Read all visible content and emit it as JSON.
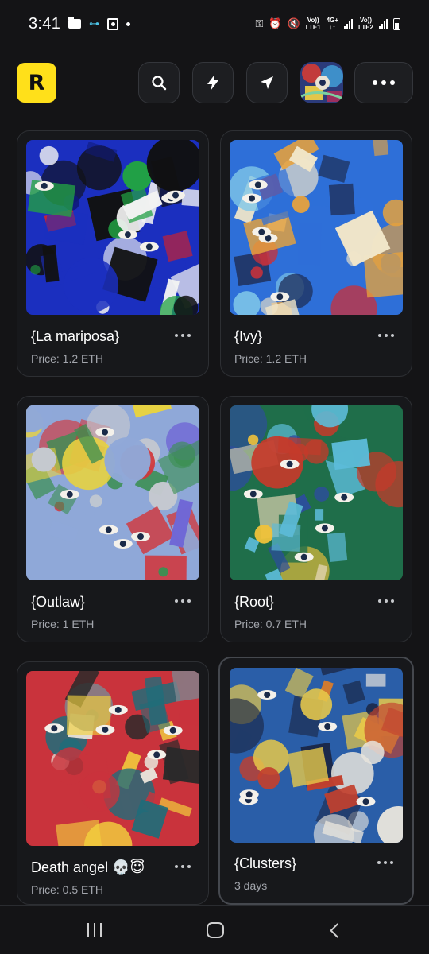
{
  "status_bar": {
    "time": "3:41",
    "net1_top": "Vo))",
    "net1_bottom": "LTE1",
    "net2_top": "4G+",
    "net3_top": "Vo))",
    "net3_bottom": "LTE2"
  },
  "app_bar": {
    "logo_letter": "R",
    "accent": "#ffe01a"
  },
  "cards": [
    {
      "title": "{La mariposa}",
      "subtitle": "Price: 1.2 ETH",
      "palette": [
        "#1b2fbf",
        "#0f1a7a",
        "#e2201c",
        "#22a243",
        "#f2f2f2",
        "#111111"
      ]
    },
    {
      "title": "{Ivy}",
      "subtitle": "Price: 1.2 ETH",
      "palette": [
        "#2e6fd8",
        "#c9313a",
        "#f1e6c8",
        "#7fc7e8",
        "#1f2f58",
        "#e9a23a"
      ]
    },
    {
      "title": "{Outlaw}",
      "subtitle": "Price: 1 ETH",
      "palette": [
        "#8fa8d8",
        "#6f67d6",
        "#e7d241",
        "#c5c9cf",
        "#d2363b",
        "#3c8f53"
      ]
    },
    {
      "title": "{Root}",
      "subtitle": "Price: 0.7 ETH",
      "palette": [
        "#1f6e4a",
        "#c53a2a",
        "#f0c23a",
        "#2d4c9e",
        "#e3d6b4",
        "#5cbbd8"
      ]
    },
    {
      "title": "Death angel 💀😇",
      "subtitle": "Price: 0.5 ETH",
      "palette": [
        "#c9333c",
        "#1f6d7a",
        "#f3d13d",
        "#7f858f",
        "#e8e2d8",
        "#2a2a2a"
      ]
    },
    {
      "title": "{Clusters}",
      "subtitle": "3 days",
      "palette": [
        "#2a5ea8",
        "#c2402e",
        "#e6c84a",
        "#e8e4dc",
        "#1a2644",
        "#d97b2a"
      ]
    }
  ]
}
